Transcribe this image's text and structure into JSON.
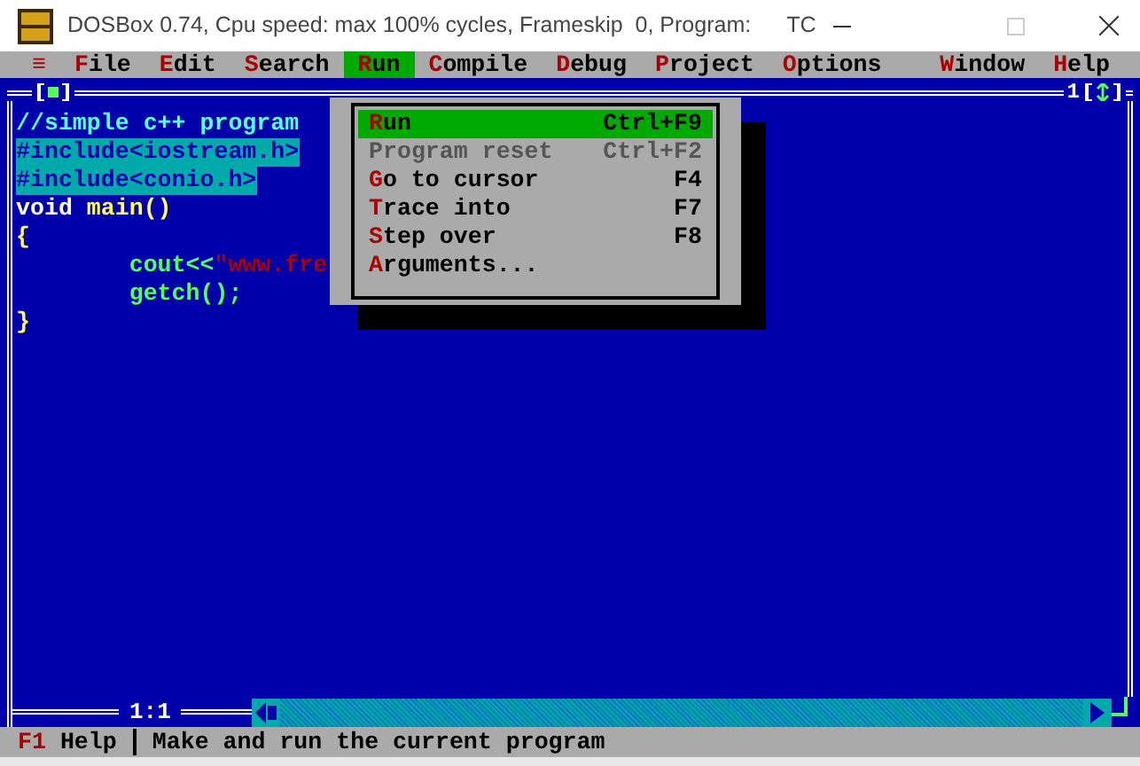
{
  "window": {
    "title": "DOSBox 0.74, Cpu speed: max 100% cycles, Frameskip  0, Program:",
    "program": "TC"
  },
  "menu_bar": {
    "system_menu": "≡",
    "items": [
      {
        "key": "F",
        "rest": "ile",
        "selected": false
      },
      {
        "key": "E",
        "rest": "dit",
        "selected": false
      },
      {
        "key": "S",
        "rest": "earch",
        "selected": false
      },
      {
        "key": "R",
        "rest": "un",
        "selected": true
      },
      {
        "key": "C",
        "rest": "ompile",
        "selected": false
      },
      {
        "key": "D",
        "rest": "ebug",
        "selected": false
      },
      {
        "key": "P",
        "rest": "roject",
        "selected": false
      },
      {
        "key": "O",
        "rest": "ptions",
        "selected": false
      },
      {
        "key": "W",
        "rest": "indow",
        "selected": false,
        "kind": "right"
      },
      {
        "key": "H",
        "rest": "elp",
        "selected": false,
        "kind": "right"
      }
    ]
  },
  "editor": {
    "window_number": "1",
    "position": "1:1",
    "lines": [
      [
        {
          "kind": "comment",
          "text": "//simple c++ program"
        }
      ],
      [
        {
          "kind": "block",
          "text": "#include<iostream.h>"
        }
      ],
      [
        {
          "kind": "block",
          "text": "#include<conio.h>"
        }
      ],
      [
        {
          "kind": "keyword",
          "text": "void"
        },
        {
          "kind": "ident",
          "text": " main()"
        }
      ],
      [
        {
          "kind": "ident",
          "text": "{"
        }
      ],
      [
        {
          "kind": "call",
          "text": "        cout<<"
        },
        {
          "kind": "string",
          "text": "\"www.fre"
        }
      ],
      [
        {
          "kind": "call",
          "text": "        getch();"
        }
      ],
      [
        {
          "kind": "ident",
          "text": "}"
        }
      ]
    ]
  },
  "run_menu": {
    "items": [
      {
        "key": "R",
        "rest": "un",
        "shortcut": "Ctrl+F9",
        "selected": true,
        "disabled": false
      },
      {
        "key": "P",
        "rest": "rogram reset",
        "shortcut": "Ctrl+F2",
        "selected": false,
        "disabled": true
      },
      {
        "key": "G",
        "rest": "o to cursor",
        "shortcut": "F4",
        "selected": false,
        "disabled": false
      },
      {
        "key": "T",
        "rest": "race into",
        "shortcut": "F7",
        "selected": false,
        "disabled": false
      },
      {
        "key": "S",
        "rest": "tep over",
        "shortcut": "F8",
        "selected": false,
        "disabled": false
      },
      {
        "key": "A",
        "rest": "rguments...",
        "selected": false,
        "disabled": false
      }
    ]
  },
  "status_bar": {
    "key": "F1",
    "label": "Help",
    "hint": "Make and run the current program"
  }
}
